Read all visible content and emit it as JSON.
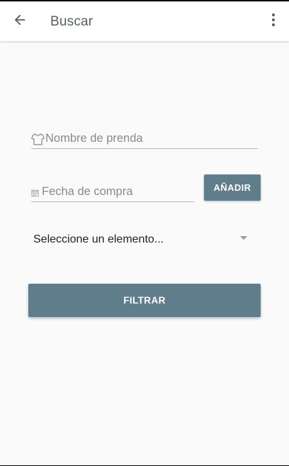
{
  "app_bar": {
    "title": "Buscar",
    "back_icon": "arrow-back-icon",
    "menu_icon": "more-vert-icon"
  },
  "form": {
    "name_field": {
      "placeholder": "Nombre de prenda",
      "value": "",
      "icon": "shirt-icon"
    },
    "date_field": {
      "placeholder": "Fecha de compra",
      "value": "",
      "icon": "calendar-icon"
    },
    "add_button_label": "AÑADIR",
    "spinner": {
      "selected": "Seleccione un elemento...",
      "icon": "dropdown-arrow-icon"
    },
    "filter_button_label": "FILTRAR"
  },
  "colors": {
    "primary": "#5f7d8a",
    "background": "#fafafa",
    "app_bar": "#ffffff",
    "title_text": "#555f66"
  }
}
